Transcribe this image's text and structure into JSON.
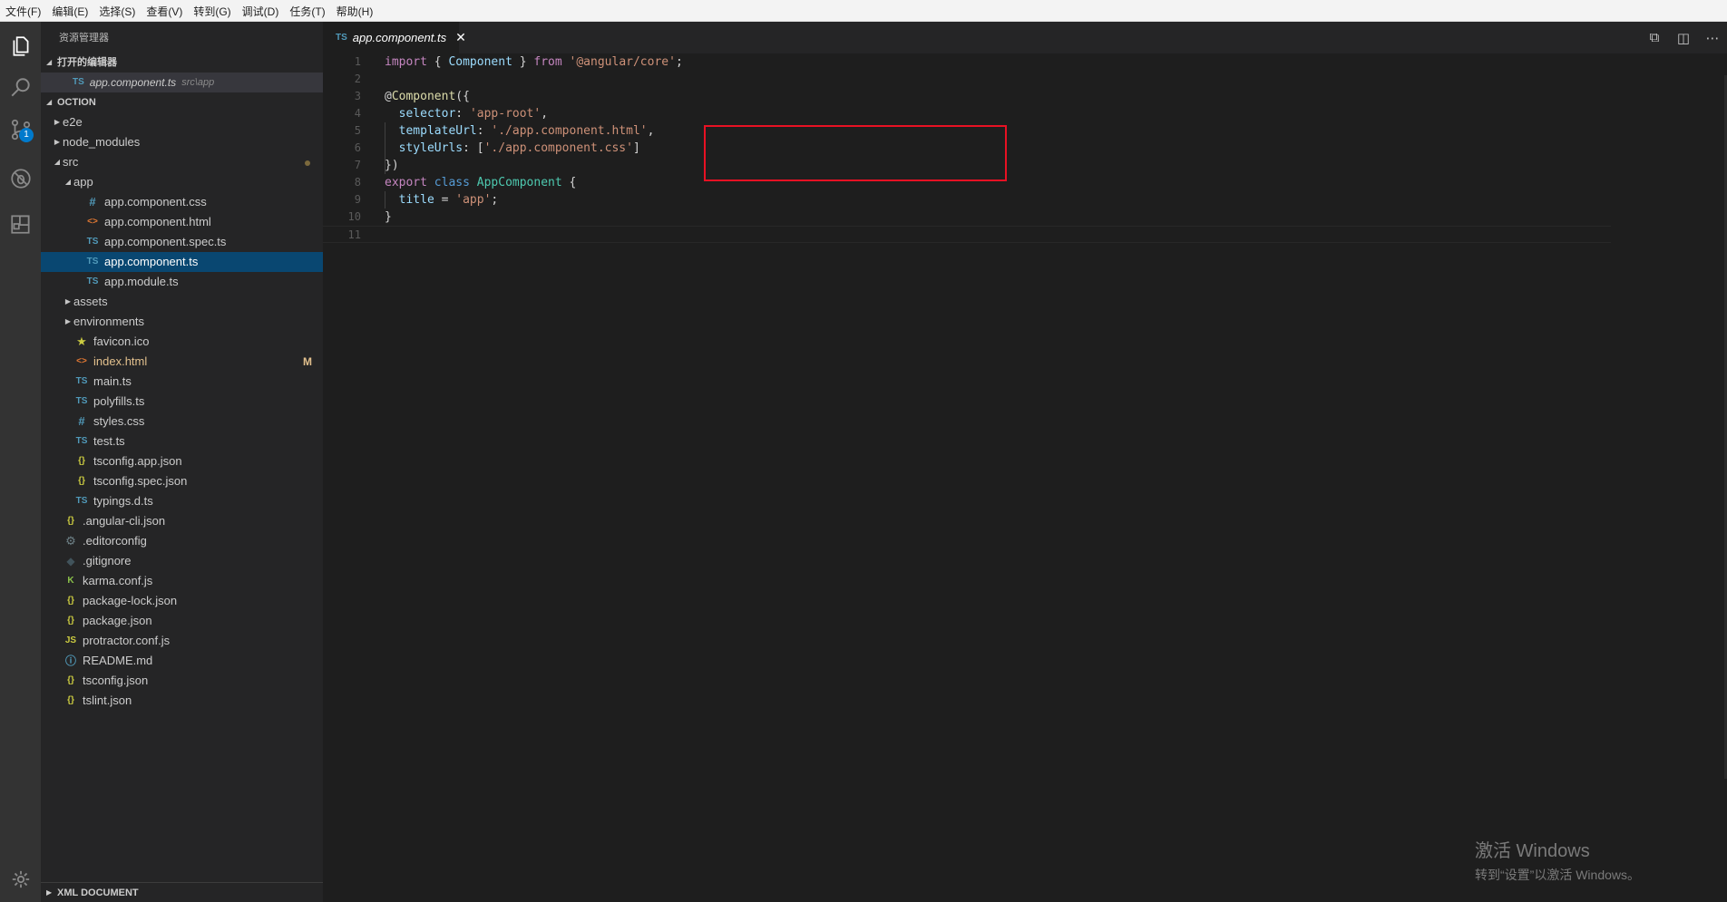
{
  "menu": [
    "文件(F)",
    "编辑(E)",
    "选择(S)",
    "查看(V)",
    "转到(G)",
    "调试(D)",
    "任务(T)",
    "帮助(H)"
  ],
  "activity": {
    "scm_badge": "1"
  },
  "sidebar": {
    "title": "资源管理器",
    "open_editors_label": "打开的编辑器",
    "open_editor": {
      "icon": "TS",
      "name": "app.component.ts",
      "path": "src\\app"
    },
    "project_label": "OCTION",
    "tree": [
      {
        "label": "e2e",
        "type": "folder",
        "expanded": false,
        "indent": 0
      },
      {
        "label": "node_modules",
        "type": "folder",
        "expanded": false,
        "indent": 0
      },
      {
        "label": "src",
        "type": "folder",
        "expanded": true,
        "indent": 0,
        "dot": true
      },
      {
        "label": "app",
        "type": "folder",
        "expanded": true,
        "indent": 1
      },
      {
        "label": "app.component.css",
        "type": "css",
        "icon": "#",
        "indent": 2
      },
      {
        "label": "app.component.html",
        "type": "html",
        "icon": "<>",
        "indent": 2
      },
      {
        "label": "app.component.spec.ts",
        "type": "ts",
        "icon": "TS",
        "indent": 2
      },
      {
        "label": "app.component.ts",
        "type": "ts",
        "icon": "TS",
        "indent": 2,
        "selected": true
      },
      {
        "label": "app.module.ts",
        "type": "ts",
        "icon": "TS",
        "indent": 2
      },
      {
        "label": "assets",
        "type": "folder",
        "expanded": false,
        "indent": 1
      },
      {
        "label": "environments",
        "type": "folder",
        "expanded": false,
        "indent": 1
      },
      {
        "label": "favicon.ico",
        "type": "star",
        "icon": "★",
        "indent": 1
      },
      {
        "label": "index.html",
        "type": "html",
        "icon": "<>",
        "indent": 1,
        "modified": "M"
      },
      {
        "label": "main.ts",
        "type": "ts",
        "icon": "TS",
        "indent": 1
      },
      {
        "label": "polyfills.ts",
        "type": "ts",
        "icon": "TS",
        "indent": 1
      },
      {
        "label": "styles.css",
        "type": "css",
        "icon": "#",
        "indent": 1
      },
      {
        "label": "test.ts",
        "type": "ts",
        "icon": "TS",
        "indent": 1
      },
      {
        "label": "tsconfig.app.json",
        "type": "json",
        "icon": "{}",
        "indent": 1
      },
      {
        "label": "tsconfig.spec.json",
        "type": "json",
        "icon": "{}",
        "indent": 1
      },
      {
        "label": "typings.d.ts",
        "type": "ts",
        "icon": "TS",
        "indent": 1
      },
      {
        "label": ".angular-cli.json",
        "type": "json",
        "icon": "{}",
        "indent": 0
      },
      {
        "label": ".editorconfig",
        "type": "gear",
        "icon": "⚙",
        "indent": 0
      },
      {
        "label": ".gitignore",
        "type": "diamond",
        "icon": "◆",
        "indent": 0
      },
      {
        "label": "karma.conf.js",
        "type": "karma",
        "icon": "K",
        "indent": 0
      },
      {
        "label": "package-lock.json",
        "type": "json",
        "icon": "{}",
        "indent": 0
      },
      {
        "label": "package.json",
        "type": "json",
        "icon": "{}",
        "indent": 0
      },
      {
        "label": "protractor.conf.js",
        "type": "js",
        "icon": "JS",
        "indent": 0
      },
      {
        "label": "README.md",
        "type": "info",
        "icon": "ⓘ",
        "indent": 0
      },
      {
        "label": "tsconfig.json",
        "type": "json",
        "icon": "{}",
        "indent": 0
      },
      {
        "label": "tslint.json",
        "type": "json",
        "icon": "{}",
        "indent": 0
      }
    ],
    "bottom_section": "XML DOCUMENT"
  },
  "editor": {
    "tab": {
      "icon": "TS",
      "name": "app.component.ts",
      "close": "✕"
    },
    "lines": [
      [
        [
          "kw2",
          "import"
        ],
        [
          "plain",
          " { "
        ],
        [
          "prop",
          "Component"
        ],
        [
          "plain",
          " } "
        ],
        [
          "kw2",
          "from"
        ],
        [
          "plain",
          " "
        ],
        [
          "str",
          "'@angular/core'"
        ],
        [
          "plain",
          ";"
        ]
      ],
      [],
      [
        [
          "plain",
          "@"
        ],
        [
          "dec2",
          "Component"
        ],
        [
          "plain",
          "({"
        ]
      ],
      [
        [
          "plain",
          "  "
        ],
        [
          "prop",
          "selector"
        ],
        [
          "plain",
          ": "
        ],
        [
          "str",
          "'app-root'"
        ],
        [
          "plain",
          ","
        ]
      ],
      [
        [
          "plain",
          "  "
        ],
        [
          "prop",
          "templateUrl"
        ],
        [
          "plain",
          ": "
        ],
        [
          "str",
          "'./app.component.html'"
        ],
        [
          "plain",
          ","
        ]
      ],
      [
        [
          "plain",
          "  "
        ],
        [
          "prop",
          "styleUrls"
        ],
        [
          "plain",
          ": ["
        ],
        [
          "str",
          "'./app.component.css'"
        ],
        [
          "plain",
          "]"
        ]
      ],
      [
        [
          "plain",
          "})"
        ]
      ],
      [
        [
          "kw2",
          "export"
        ],
        [
          "plain",
          " "
        ],
        [
          "kw",
          "class"
        ],
        [
          "plain",
          " "
        ],
        [
          "cls",
          "AppComponent"
        ],
        [
          "plain",
          " {"
        ]
      ],
      [
        [
          "plain",
          "  "
        ],
        [
          "prop",
          "title"
        ],
        [
          "plain",
          " = "
        ],
        [
          "str",
          "'app'"
        ],
        [
          "plain",
          ";"
        ]
      ],
      [
        [
          "plain",
          "}"
        ]
      ],
      []
    ]
  },
  "watermark": {
    "line1": "激活 Windows",
    "line2": "转到“设置”以激活 Windows。"
  }
}
